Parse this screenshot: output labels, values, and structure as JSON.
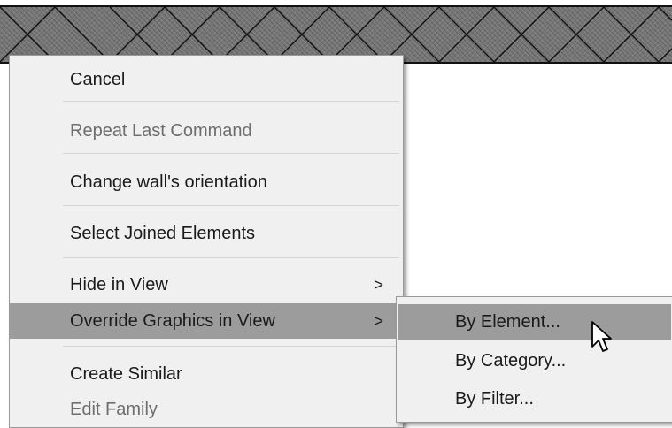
{
  "context_menu": {
    "items": [
      {
        "label": "Cancel",
        "enabled": true
      },
      {
        "label": "Repeat Last Command",
        "enabled": false
      },
      {
        "label": "Change wall's orientation",
        "enabled": true
      },
      {
        "label": "Select Joined Elements",
        "enabled": true
      },
      {
        "label": "Hide in View",
        "enabled": true,
        "submenu_arrow": ">"
      },
      {
        "label": "Override Graphics in View",
        "enabled": true,
        "submenu_arrow": ">",
        "highlighted": true
      },
      {
        "label": "Create Similar",
        "enabled": true
      },
      {
        "label": "Edit Family",
        "enabled": false
      }
    ]
  },
  "submenu": {
    "items": [
      {
        "label": "By Element...",
        "highlighted": true
      },
      {
        "label": "By Category..."
      },
      {
        "label": "By Filter..."
      }
    ]
  },
  "colors": {
    "menu_background": "#f0f0f0",
    "highlight": "#9c9c9c",
    "disabled_text": "#6d6d6d",
    "wall_fill": "#777777"
  }
}
